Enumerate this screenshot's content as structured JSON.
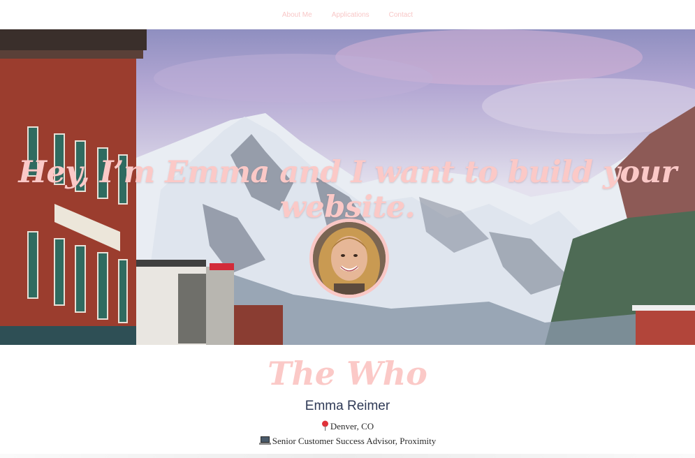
{
  "nav": {
    "items": [
      {
        "label": "About Me"
      },
      {
        "label": "Applications"
      },
      {
        "label": "Contact"
      }
    ]
  },
  "hero": {
    "title": "Hey, I’m Emma and I want to build your website.",
    "avatar_icon": "portrait-photo"
  },
  "about": {
    "heading": "The Who",
    "name": "Emma Reimer",
    "location_icon": "pin-icon",
    "location": "Denver, CO",
    "job_icon": "laptop-icon",
    "job": "Senior Customer Success Advisor, Proximity"
  },
  "colors": {
    "accent_pink": "#fbc9c7",
    "name_navy": "#2f3a56"
  }
}
